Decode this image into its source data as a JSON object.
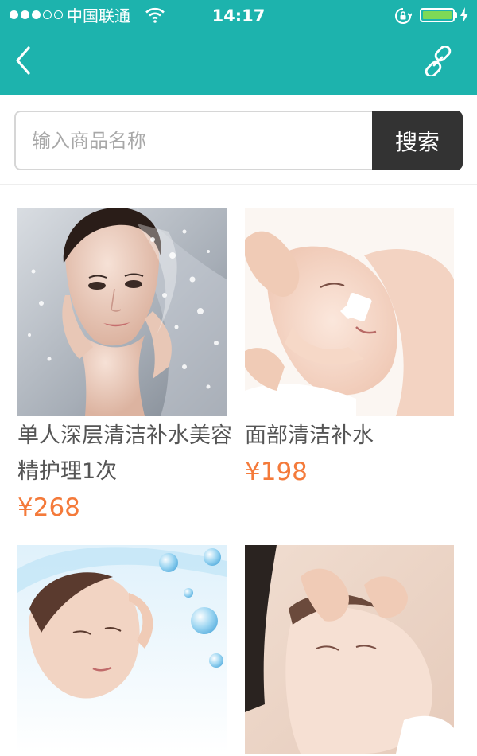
{
  "status_bar": {
    "carrier": "中国联通",
    "time": "14:17"
  },
  "search": {
    "placeholder": "输入商品名称",
    "value": "",
    "button_label": "搜索"
  },
  "products": [
    {
      "title": "单人深层清洁补水美容精护理1次",
      "price": "¥268"
    },
    {
      "title": "面部清洁补水",
      "price": "¥198"
    },
    {
      "title": "",
      "price": ""
    },
    {
      "title": "",
      "price": ""
    }
  ],
  "colors": {
    "header": "#1db3ad",
    "price": "#f47a3a",
    "search_button": "#333333",
    "battery": "#7ed957"
  },
  "icons": {
    "back": "chevron-left-icon",
    "share": "link-icon",
    "wifi": "wifi-icon",
    "lock": "rotation-lock-icon",
    "battery": "battery-icon",
    "charge": "charging-bolt-icon"
  }
}
